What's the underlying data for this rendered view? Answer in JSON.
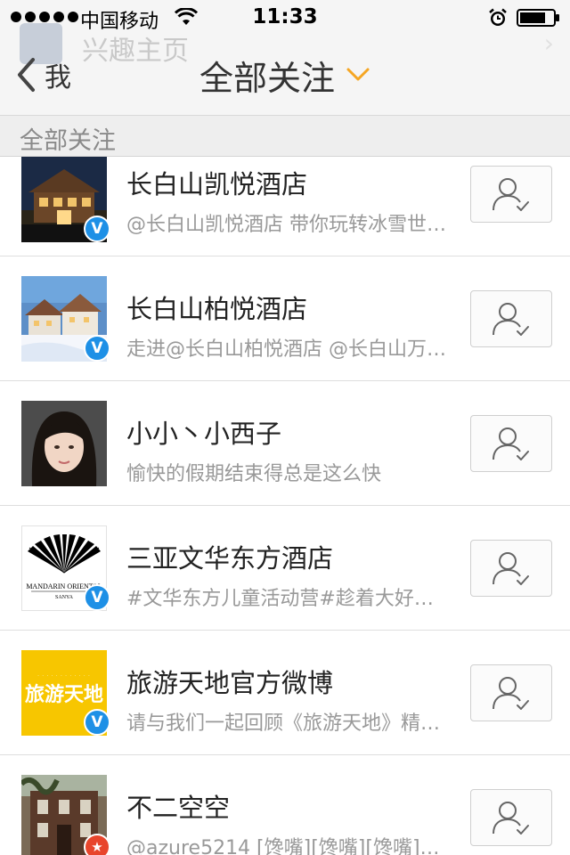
{
  "status_bar": {
    "carrier": "中国移动",
    "time": "11:33",
    "signal_bars": 5
  },
  "ghost_banner": {
    "title": "兴趣主页"
  },
  "nav": {
    "back_label": "我",
    "title": "全部关注",
    "accent_color": "#f5a623"
  },
  "section": {
    "header": "全部关注"
  },
  "colors": {
    "verified": "#1e90e6",
    "star_badge": "#e8452c"
  },
  "follow_list": [
    {
      "name": "长白山凯悦酒店",
      "description": "@长白山凯悦酒店 带你玩转冰雪世界…",
      "badge": "verified",
      "avatar_icon": "hotel-lodge-photo",
      "follow_icon": "followed-user-icon"
    },
    {
      "name": "长白山柏悦酒店",
      "description": "走进@长白山柏悦酒店 @长白山万达…",
      "badge": "verified",
      "avatar_icon": "snow-resort-photo",
      "follow_icon": "followed-user-icon"
    },
    {
      "name": "小小丶小西子",
      "description": "愉快的假期结束得总是这么快",
      "badge": "none",
      "avatar_icon": "portrait-photo",
      "follow_icon": "followed-user-icon"
    },
    {
      "name": "三亚文华东方酒店",
      "description": "#文华东方儿童活动营#趁着大好时光…",
      "badge": "verified",
      "avatar_icon": "mandarin-oriental-logo",
      "avatar_logo_text": "MANDARIN ORIENTAL",
      "avatar_logo_sub": "SANYA",
      "follow_icon": "followed-user-icon"
    },
    {
      "name": "旅游天地官方微博",
      "description": "请与我们一起回顾《旅游天地》精彩…",
      "badge": "verified",
      "avatar_icon": "travel-world-logo",
      "avatar_logo_text": "旅游天地",
      "follow_icon": "followed-user-icon"
    },
    {
      "name": "不二空空",
      "description": "@azure5214 [馋嘴][馋嘴][馋嘴]…",
      "badge": "star",
      "avatar_icon": "building-photo",
      "follow_icon": "followed-user-icon"
    }
  ]
}
